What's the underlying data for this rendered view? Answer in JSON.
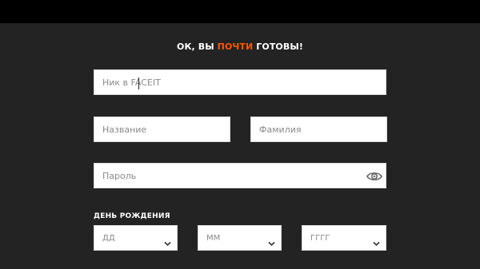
{
  "heading": {
    "before": "ОК, ВЫ ",
    "accent": "ПОЧТИ",
    "after": " ГОТОВЫ!"
  },
  "form": {
    "nickname_placeholder": "Ник в FACEIT",
    "first_name_placeholder": "Название",
    "last_name_placeholder": "Фамилия",
    "password_placeholder": "Пароль",
    "birthday_label": "ДЕНЬ РОЖДЕНИЯ",
    "day_value": "ДД",
    "month_value": "ММ",
    "year_value": "ГГГГ"
  },
  "icons": {
    "password_toggle": "eye-icon",
    "dropdown": "chevron-down-icon"
  },
  "colors": {
    "accent": "#ff5500",
    "background": "#232323",
    "top_bar": "#000000"
  }
}
